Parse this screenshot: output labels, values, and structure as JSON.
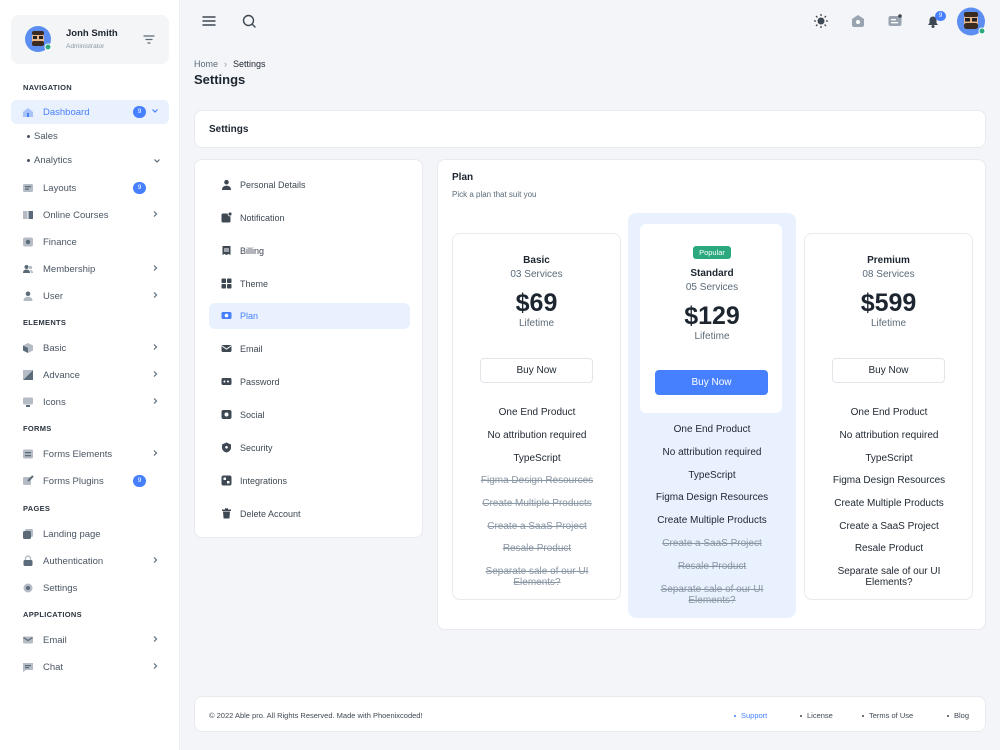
{
  "colors": {
    "primary": "#4680ff",
    "success": "#2ca87f",
    "text": "#1d2630",
    "muted": "#5b6b79"
  },
  "user": {
    "name": "Jonh Smith",
    "role": "Administrator"
  },
  "sidebar": {
    "sections": {
      "navigation": "NAVIGATION",
      "elements": "ELEMENTS",
      "forms": "FORMS",
      "pages": "PAGES",
      "applications": "APPLICATIONS"
    },
    "dashboard": {
      "label": "Dashboard",
      "badge": "9"
    },
    "sub": {
      "sales": "Sales",
      "analytics": "Analytics"
    },
    "layouts": {
      "label": "Layouts",
      "badge": "9"
    },
    "courses": {
      "label": "Online Courses"
    },
    "finance": {
      "label": "Finance"
    },
    "membership": {
      "label": "Membership"
    },
    "user": {
      "label": "User"
    },
    "basic": {
      "label": "Basic"
    },
    "advance": {
      "label": "Advance"
    },
    "icons": {
      "label": "Icons"
    },
    "forms_elements": {
      "label": "Forms Elements"
    },
    "forms_plugins": {
      "label": "Forms Plugins",
      "badge": "9"
    },
    "landing": {
      "label": "Landing page"
    },
    "auth": {
      "label": "Authentication"
    },
    "settings": {
      "label": "Settings"
    },
    "email": {
      "label": "Email"
    },
    "chat": {
      "label": "Chat"
    }
  },
  "topbar": {
    "notification_count": "9"
  },
  "breadcrumb": {
    "home": "Home",
    "current": "Settings"
  },
  "page_title": "Settings",
  "settings_header": "Settings",
  "settings_menu": {
    "personal": "Personal Details",
    "notification": "Notification",
    "billing": "Billing",
    "theme": "Theme",
    "plan": "Plan",
    "email": "Email",
    "password": "Password",
    "social": "Social",
    "security": "Security",
    "integrations": "Integrations",
    "delete": "Delete Account"
  },
  "plan": {
    "title": "Plan",
    "subtitle": "Pick a plan that suit you",
    "basic": {
      "name": "Basic",
      "services": "03 Services",
      "price": "$69",
      "period": "Lifetime",
      "button": "Buy Now",
      "features": [
        "One End Product",
        "No attribution required",
        "TypeScript",
        "Figma Design Resources",
        "Create Multiple Products",
        "Create a SaaS Project",
        "Resale Product",
        "Separate sale of our UI Elements?"
      ]
    },
    "standard": {
      "badge": "Popular",
      "name": "Standard",
      "services": "05 Services",
      "price": "$129",
      "period": "Lifetime",
      "button": "Buy Now",
      "features": [
        "One End Product",
        "No attribution required",
        "TypeScript",
        "Figma Design Resources",
        "Create Multiple Products",
        "Create a SaaS Project",
        "Resale Product",
        "Separate sale of our UI Elements?"
      ]
    },
    "premium": {
      "name": "Premium",
      "services": "08 Services",
      "price": "$599",
      "period": "Lifetime",
      "button": "Buy Now",
      "features": [
        "One End Product",
        "No attribution required",
        "TypeScript",
        "Figma Design Resources",
        "Create Multiple Products",
        "Create a SaaS Project",
        "Resale Product",
        "Separate sale of our UI Elements?"
      ]
    }
  },
  "footer": {
    "copyright": "© 2022 Able pro. All Rights Reserved. Made with Phoenixcoded!",
    "support": "Support",
    "license": "License",
    "terms": "Terms of Use",
    "blog": "Blog"
  }
}
